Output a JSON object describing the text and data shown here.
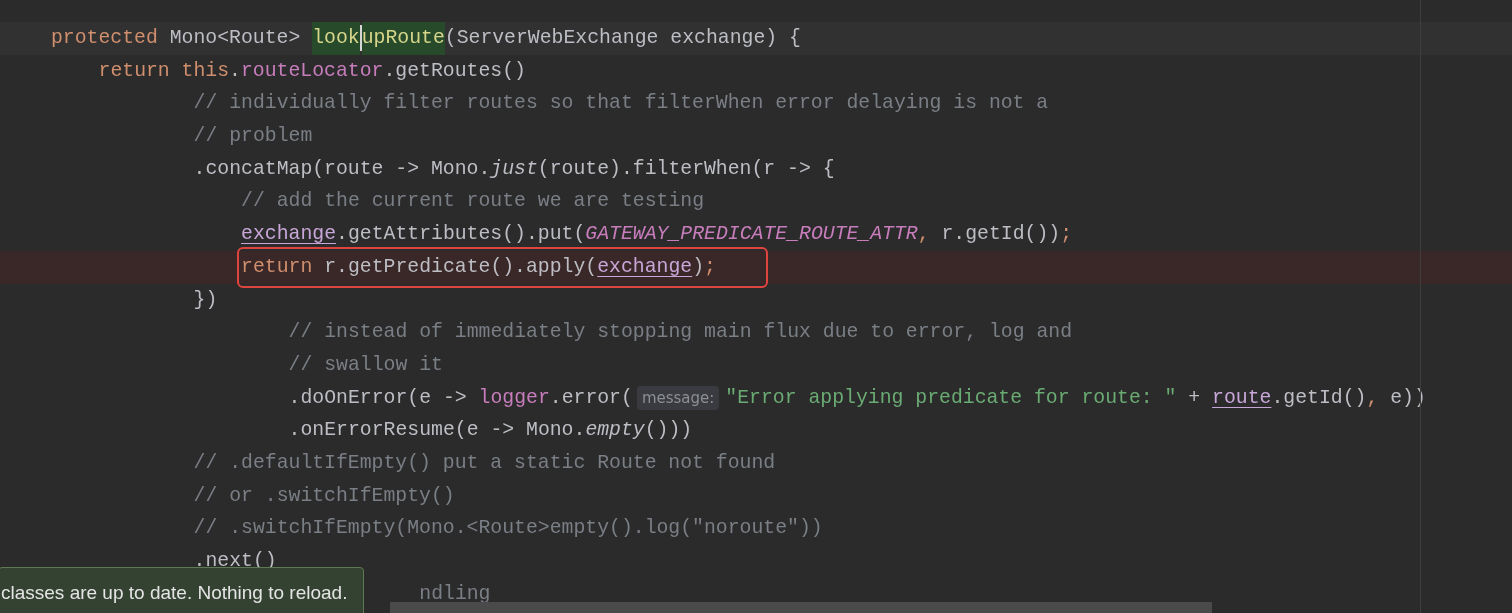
{
  "editor": {
    "lines": [
      {
        "marked": false,
        "tokens": [
          {
            "kind": "keyword",
            "text": "protected "
          },
          {
            "kind": "plain",
            "text": "Mono<Route> "
          },
          {
            "kind": "declaration",
            "text": "look",
            "caret": true
          },
          {
            "kind": "declaration",
            "text": "upRoute",
            "caret": false
          },
          {
            "kind": "plain",
            "text": "(ServerWebExchange exchange) {"
          }
        ]
      },
      {
        "marked": false,
        "tokens": [
          {
            "kind": "keyword",
            "text": "return this"
          },
          {
            "kind": "plain",
            "text": "."
          },
          {
            "kind": "field",
            "text": "routeLocator"
          },
          {
            "kind": "plain",
            "text": ".getRoutes()"
          }
        ]
      },
      {
        "marked": false,
        "tokens": [
          {
            "kind": "comment",
            "text": "// individually filter routes so that filterWhen error delaying is not a"
          }
        ]
      },
      {
        "marked": false,
        "tokens": [
          {
            "kind": "comment",
            "text": "// problem"
          }
        ]
      },
      {
        "marked": false,
        "tokens": [
          {
            "kind": "plain",
            "text": ".concatMap(route -> Mono."
          },
          {
            "kind": "italic",
            "text": "just"
          },
          {
            "kind": "plain",
            "text": "(route).filterWhen(r -> {"
          }
        ]
      },
      {
        "marked": false,
        "tokens": [
          {
            "kind": "comment",
            "text": "// add the current route we are testing"
          }
        ]
      },
      {
        "marked": false,
        "tokens": [
          {
            "kind": "reference",
            "text": "exchange"
          },
          {
            "kind": "plain",
            "text": ".getAttributes().put("
          },
          {
            "kind": "constant",
            "text": "GATEWAY_PREDICATE_ROUTE_ATTR"
          },
          {
            "kind": "keyword",
            "text": ", "
          },
          {
            "kind": "plain",
            "text": "r.getId())"
          },
          {
            "kind": "keyword",
            "text": ";"
          }
        ]
      },
      {
        "marked": true,
        "tokens": [
          {
            "kind": "keyword",
            "text": "return "
          },
          {
            "kind": "plain",
            "text": "r.getPredicate().apply("
          },
          {
            "kind": "reference",
            "text": "exchange"
          },
          {
            "kind": "plain",
            "text": ")"
          },
          {
            "kind": "keyword",
            "text": ";"
          }
        ]
      },
      {
        "marked": false,
        "tokens": [
          {
            "kind": "plain",
            "text": "})"
          }
        ]
      },
      {
        "marked": false,
        "tokens": [
          {
            "kind": "comment",
            "text": "// instead of immediately stopping main flux due to error, log and"
          }
        ]
      },
      {
        "marked": false,
        "tokens": [
          {
            "kind": "comment",
            "text": "// swallow it"
          }
        ]
      },
      {
        "marked": false,
        "tokens": [
          {
            "kind": "plain",
            "text": ".doOnError(e -> "
          },
          {
            "kind": "field",
            "text": "logger"
          },
          {
            "kind": "plain",
            "text": ".error("
          },
          {
            "kind": "hint",
            "text": "message:"
          },
          {
            "kind": "string",
            "text": "\"Error applying predicate for route: \""
          },
          {
            "kind": "plain",
            "text": " + "
          },
          {
            "kind": "reference",
            "text": "route"
          },
          {
            "kind": "plain",
            "text": ".getId()"
          },
          {
            "kind": "keyword",
            "text": ","
          },
          {
            "kind": "plain",
            "text": " e))"
          }
        ]
      },
      {
        "marked": false,
        "tokens": [
          {
            "kind": "plain",
            "text": ".onErrorResume(e -> Mono."
          },
          {
            "kind": "italic",
            "text": "empty"
          },
          {
            "kind": "plain",
            "text": "()))"
          }
        ]
      },
      {
        "marked": false,
        "tokens": [
          {
            "kind": "comment",
            "text": "// .defaultIfEmpty() put a static Route not found"
          }
        ]
      },
      {
        "marked": false,
        "tokens": [
          {
            "kind": "comment",
            "text": "// or .switchIfEmpty()"
          }
        ]
      },
      {
        "marked": false,
        "tokens": [
          {
            "kind": "comment",
            "text": "// .switchIfEmpty(Mono.<Route>empty().log(\"noroute\"))"
          }
        ]
      },
      {
        "marked": false,
        "tokens": [
          {
            "kind": "plain",
            "text": ".next()"
          }
        ]
      },
      {
        "marked": false,
        "tokens": [
          {
            "kind": "comment",
            "text": "ndling"
          }
        ]
      }
    ]
  },
  "notification": {
    "text": "classes are up to date. Nothing to reload."
  }
}
